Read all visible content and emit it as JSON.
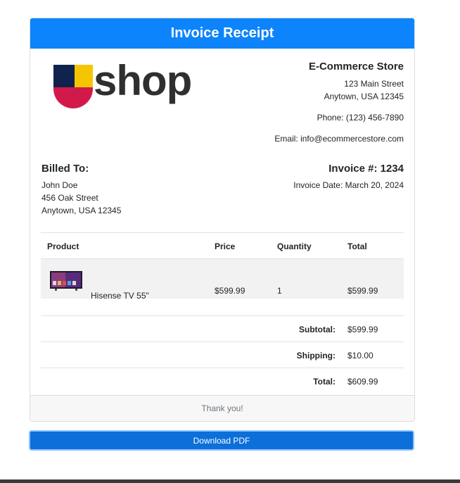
{
  "header": {
    "title": "Invoice Receipt"
  },
  "logo": {
    "text": "shop",
    "icon": "u-logo-icon",
    "colors": {
      "navy": "#10234e",
      "yellow": "#f4c600",
      "crimson": "#d21a4a",
      "text": "#2f2f2f"
    }
  },
  "store": {
    "name": "E-Commerce Store",
    "street": "123 Main Street",
    "city": "Anytown, USA 12345",
    "phone": "Phone: (123) 456-7890",
    "email": "Email: info@ecommercestore.com"
  },
  "billed_to": {
    "title": "Billed To:",
    "name": "John Doe",
    "street": "456 Oak Street",
    "city": "Anytown, USA 12345"
  },
  "invoice": {
    "number": "Invoice #: 1234",
    "date": "Invoice Date: March 20, 2024"
  },
  "table": {
    "headers": [
      "Product",
      "Price",
      "Quantity",
      "Total"
    ],
    "rows": [
      {
        "product": "Hisense TV 55\"",
        "price": "$599.99",
        "quantity": "1",
        "total": "$599.99",
        "icon": "tv-thumbnail"
      }
    ]
  },
  "summary": {
    "subtotal_label": "Subtotal:",
    "subtotal": "$599.99",
    "shipping_label": "Shipping:",
    "shipping": "$10.00",
    "total_label": "Total:",
    "total": "$609.99"
  },
  "footer": {
    "text": "Thank you!"
  },
  "actions": {
    "download_label": "Download PDF"
  },
  "colors": {
    "header_bg": "#0d84fb",
    "button_bg": "#0d6fd9"
  }
}
